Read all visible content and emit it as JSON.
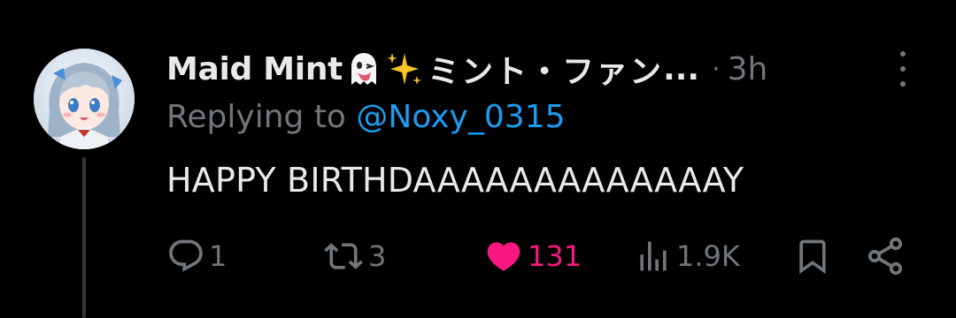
{
  "tweet": {
    "display_name": "Maid Mint",
    "emojis": [
      "ghost-tongue-emoji",
      "sparkles-emoji"
    ],
    "jp_name": "ミント・ファン",
    "ellipsis": "...",
    "separator": "·",
    "time": "3h",
    "replying_prefix": "Replying to ",
    "replying_handle": "@Noxy_0315",
    "text": "HAPPY BIRTHDAAAAAAAAAAAAAY"
  },
  "actions": {
    "reply_count": "1",
    "retweet_count": "3",
    "like_count": "131",
    "views_count": "1.9K"
  },
  "colors": {
    "background": "#000000",
    "text_primary": "#e7e9ea",
    "text_secondary": "#71767b",
    "link": "#1d9bf0",
    "like": "#f91880",
    "thread_line": "#333639"
  },
  "icons": {
    "reply": "reply-icon",
    "retweet": "retweet-icon",
    "like": "heart-icon",
    "views": "views-icon",
    "bookmark": "bookmark-icon",
    "share": "share-icon",
    "more": "more-icon"
  }
}
